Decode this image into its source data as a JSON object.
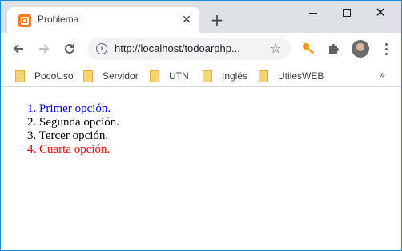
{
  "tab": {
    "title": "Problema"
  },
  "toolbar": {
    "url": "http://localhost/todoarphp..."
  },
  "bookmarks": {
    "items": [
      {
        "label": "PocoUso"
      },
      {
        "label": "Servidor"
      },
      {
        "label": "UTN"
      },
      {
        "label": "Inglés"
      },
      {
        "label": "UtilesWEB"
      }
    ]
  },
  "content": {
    "items": [
      {
        "number": "1.",
        "text": "Primer opción.",
        "color": "#0000ff"
      },
      {
        "number": "2.",
        "text": "Segunda opción.",
        "color": "#000000"
      },
      {
        "number": "3.",
        "text": "Tercer opción.",
        "color": "#000000"
      },
      {
        "number": "4.",
        "text": "Cuarta opción.",
        "color": "#ff0000"
      }
    ]
  },
  "icons": {
    "favicon": "xampp-icon",
    "close": "close-icon",
    "new_tab": "plus-icon",
    "back": "back-arrow-icon",
    "forward": "forward-arrow-icon",
    "reload": "reload-icon",
    "info": "info-icon",
    "star": "star-icon",
    "key": "key-icon",
    "extensions": "puzzle-icon",
    "menu": "more-vert-icon",
    "folder": "folder-icon",
    "more": "chevron-double-right-icon"
  }
}
